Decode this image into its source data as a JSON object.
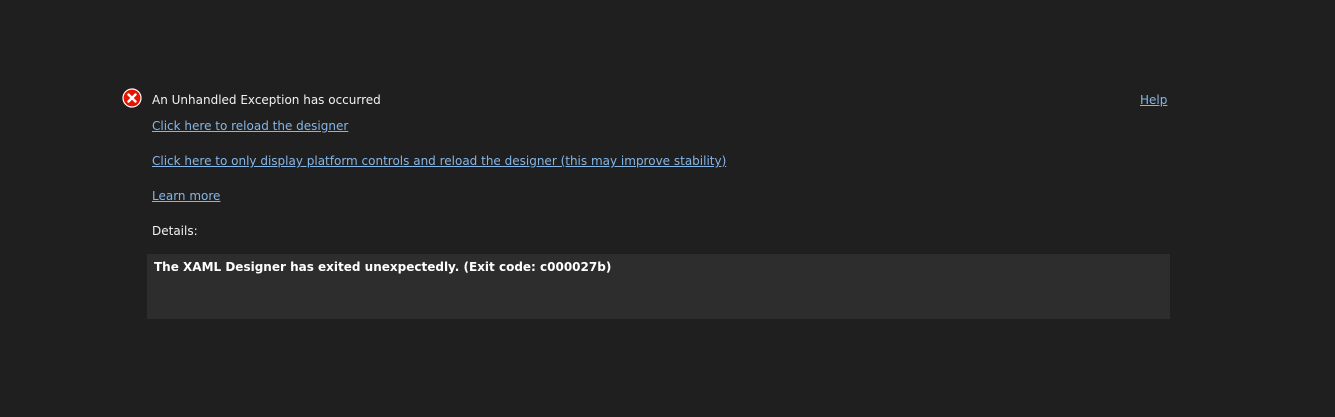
{
  "error": {
    "icon": "error-circle-x-icon",
    "title": "An Unhandled Exception has occurred",
    "help_label": "Help"
  },
  "links": {
    "reload": "Click here to reload the designer",
    "platform_controls": "Click here to only display platform controls and reload the designer (this may improve stability)",
    "learn_more": "Learn more"
  },
  "details": {
    "label": "Details:",
    "message": "The XAML Designer has exited unexpectedly. (Exit code: c000027b)"
  },
  "colors": {
    "background": "#1f1f1f",
    "details_background": "#2d2d2d",
    "link": "#86b6e6",
    "error_red": "#e51400",
    "text": "#f1f1f1"
  }
}
